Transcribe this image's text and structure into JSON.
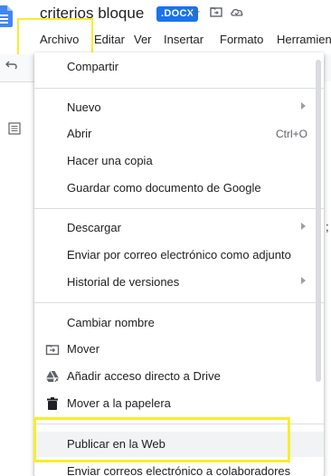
{
  "document": {
    "title": "criterios bloque",
    "badge": ".DOCX"
  },
  "title_icons": [
    "star-icon",
    "folder-move-icon",
    "cloud-status-icon"
  ],
  "menubar": {
    "items": [
      "Archivo",
      "Editar",
      "Ver",
      "Insertar",
      "Formato",
      "Herramien"
    ]
  },
  "file_menu": {
    "compartir": "Compartir",
    "nuevo": "Nuevo",
    "abrir": "Abrir",
    "abrir_shortcut": "Ctrl+O",
    "copia": "Hacer una copia",
    "guardar": "Guardar como documento de Google",
    "descargar": "Descargar",
    "enviar_adjunto": "Enviar por correo electrónico como adjunto",
    "historial": "Historial de versiones",
    "cambiar_nombre": "Cambiar nombre",
    "mover": "Mover",
    "acceso_directo": "Añadir acceso directo a Drive",
    "papelera": "Mover a la papelera",
    "publicar": "Publicar en la Web",
    "enviar_colaboradores": "Enviar correos electrónico a colaboradores"
  },
  "colors": {
    "highlight": "#f6ee2c",
    "badge": "#1a73e8",
    "doc_icon": "#4285f4"
  }
}
